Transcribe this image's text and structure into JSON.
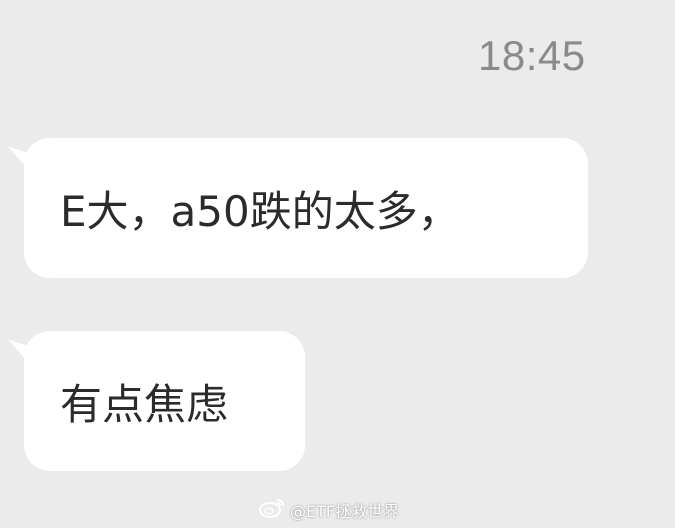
{
  "status": {
    "time": "18:45"
  },
  "messages": [
    {
      "text": "E大，a50跌的太多，"
    },
    {
      "text": "有点焦虑"
    }
  ],
  "watermark": {
    "icon": "weibo-logo-icon",
    "handle": "@ETF拯救世界"
  },
  "colors": {
    "background": "#ebebeb",
    "bubble": "#ffffff",
    "timestamp": "#8a8a8a",
    "text": "#2b2b2b"
  }
}
